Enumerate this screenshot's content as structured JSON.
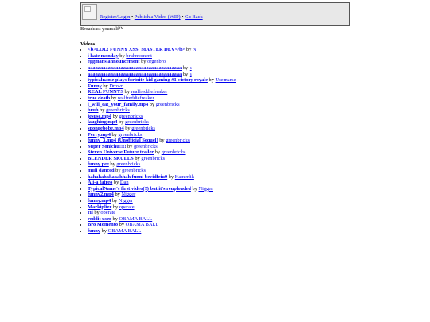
{
  "header": {
    "logo_icon": "broken-image-icon",
    "nav": [
      {
        "label": "Register/Login"
      },
      {
        "label": "Publish a Video (WIP)"
      },
      {
        "label": "Go Back"
      }
    ],
    "separator": " • ",
    "tagline": "Broadcast yourself™"
  },
  "videos_heading": "Videos",
  "by_text": " by ",
  "videos": [
    {
      "title": "<b>LOL! FUNNY XSS! MASTER DEV</b>",
      "author": "N"
    },
    {
      "title": "i hate monday",
      "author": "bruhmoment"
    },
    {
      "title": "eggmans announcement",
      "author": "orgenbro"
    },
    {
      "title": "aaaaaaaaaaaaaaaaaaaaaaaaaaaaaaaaaaaaa",
      "author": "a"
    },
    {
      "title": "aaaaaaaaaaaaaaaaaaaaaaaaaaaaaaaaaaaaa",
      "author": "a"
    },
    {
      "title": "typicalname plays fortnite kid gaming #1 victory royale",
      "author": "Username"
    },
    {
      "title": "Funny",
      "author": "Drown"
    },
    {
      "title": "REAL FUNNYS",
      "author": "realfreddiefreaker"
    },
    {
      "title": "true death",
      "author": "realfreddiefreaker"
    },
    {
      "title": "i_will_eat_your_family.mp4",
      "author": "greenbricks"
    },
    {
      "title": "bruh",
      "author": "greenbricks"
    },
    {
      "title": "jesuse.mp4",
      "author": "greenbricks"
    },
    {
      "title": "laughing.mp4",
      "author": "greenbricks"
    },
    {
      "title": "spongebobe.mp4",
      "author": "greenbricks"
    },
    {
      "title": "Perry.mp4",
      "author": "greenbricks"
    },
    {
      "title": "funny_3.mp4 (Unofficial Sequel)",
      "author": "greenbricks"
    },
    {
      "title": "Super Sonichu!!!!",
      "author": "greenbricks"
    },
    {
      "title": "Steven Universe Future trailer",
      "author": "greenbricks"
    },
    {
      "title": "BLENDER SKULLS",
      "author": "greenbricks"
    },
    {
      "title": "funny pee",
      "author": "greenbricks"
    },
    {
      "title": "mull danced",
      "author": "greenbricks"
    },
    {
      "title": "hahahahahaaahhah funni bevidfeiu9",
      "author": "Hamerlik"
    },
    {
      "title": "Ali-a fatreo",
      "author": "Dan"
    },
    {
      "title": "TypicalName's first video(?) but it's reuploaded",
      "author": "Nigger"
    },
    {
      "title": "funny2.mp4",
      "author": "Nigger"
    },
    {
      "title": "funny.mp4",
      "author": "Nigger"
    },
    {
      "title": "Markiplier",
      "author": "operate"
    },
    {
      "title": "Hi",
      "author": "operate"
    },
    {
      "title": "reddit user",
      "author": "OBAMA BALL"
    },
    {
      "title": "Bro Momento",
      "author": "OBAMA BALL"
    },
    {
      "title": "funny",
      "author": "OBAMA BALL"
    }
  ]
}
